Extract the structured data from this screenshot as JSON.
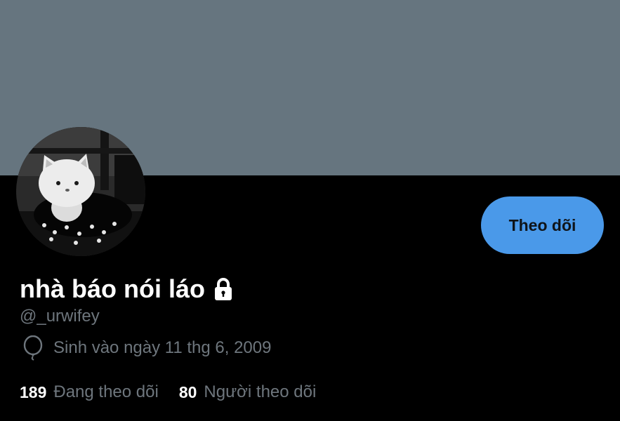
{
  "profile": {
    "display_name": "nhà báo nói láo",
    "handle": "@_urwifey",
    "birthday": "Sinh vào ngày 11 thg 6, 2009",
    "protected_icon": "lock-icon",
    "birthday_icon": "balloon-icon"
  },
  "actions": {
    "follow_label": "Theo dõi"
  },
  "stats": {
    "following_count": "189",
    "following_label": "Đang theo dõi",
    "followers_count": "80",
    "followers_label": "Người theo dõi"
  },
  "colors": {
    "banner": "#66757f",
    "background": "#000000",
    "follow_button": "#4a99e9",
    "secondary_text": "#6e767d",
    "primary_text": "#ffffff"
  }
}
